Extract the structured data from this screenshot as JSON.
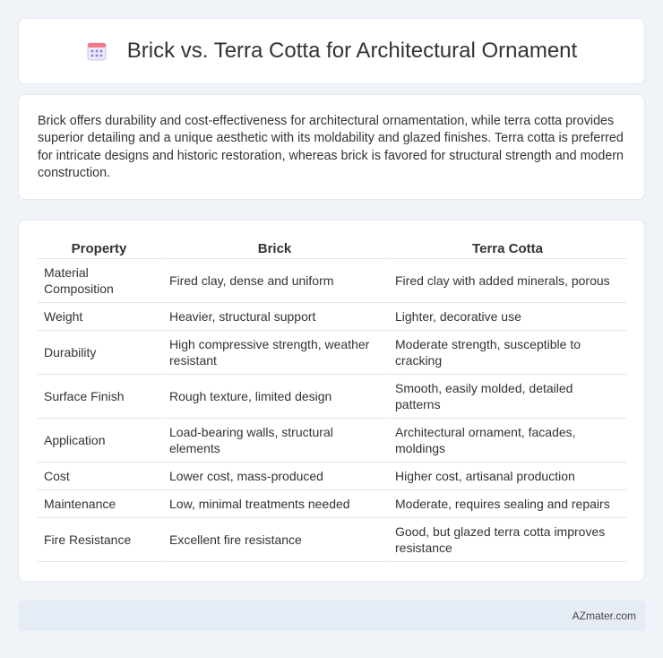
{
  "header": {
    "title": "Brick vs. Terra Cotta for Architectural Ornament",
    "icon": "calendar-icon"
  },
  "summary": {
    "text": "Brick offers durability and cost-effectiveness for architectural ornamentation, while terra cotta provides superior detailing and a unique aesthetic with its moldability and glazed finishes. Terra cotta is preferred for intricate designs and historic restoration, whereas brick is favored for structural strength and modern construction."
  },
  "table": {
    "headers": [
      "Property",
      "Brick",
      "Terra Cotta"
    ],
    "rows": [
      [
        "Material Composition",
        "Fired clay, dense and uniform",
        "Fired clay with added minerals, porous"
      ],
      [
        "Weight",
        "Heavier, structural support",
        "Lighter, decorative use"
      ],
      [
        "Durability",
        "High compressive strength, weather resistant",
        "Moderate strength, susceptible to cracking"
      ],
      [
        "Surface Finish",
        "Rough texture, limited design",
        "Smooth, easily molded, detailed patterns"
      ],
      [
        "Application",
        "Load-bearing walls, structural elements",
        "Architectural ornament, facades, moldings"
      ],
      [
        "Cost",
        "Lower cost, mass-produced",
        "Higher cost, artisanal production"
      ],
      [
        "Maintenance",
        "Low, minimal treatments needed",
        "Moderate, requires sealing and repairs"
      ],
      [
        "Fire Resistance",
        "Excellent fire resistance",
        "Good, but glazed terra cotta improves resistance"
      ]
    ]
  },
  "footer": {
    "brand": "AZmater.com"
  },
  "colors": {
    "background": "#f0f3f8",
    "footer_bg": "#e6ecf6",
    "icon_accent": "#8a7fd8"
  }
}
